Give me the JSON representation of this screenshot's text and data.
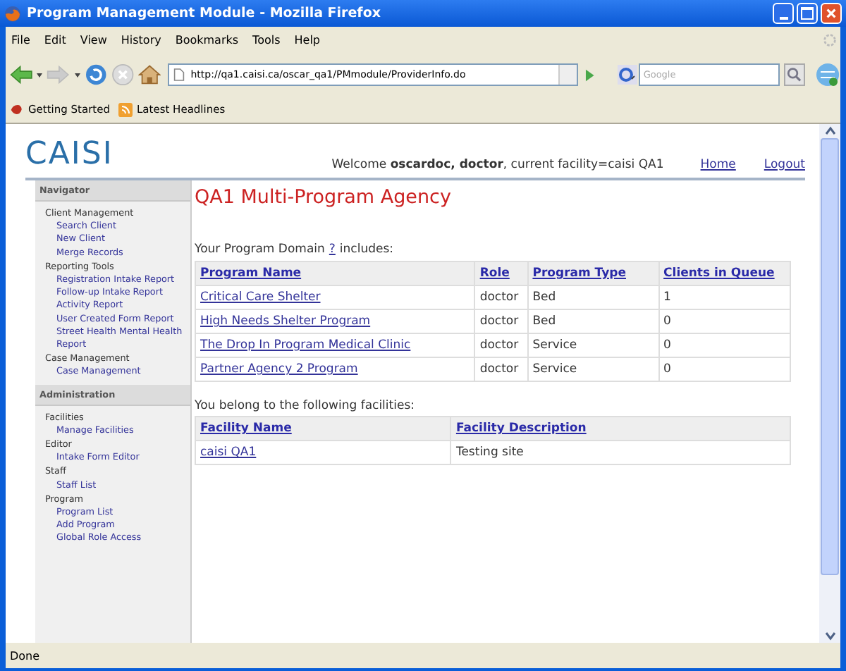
{
  "window": {
    "title": "Program Management Module - Mozilla Firefox"
  },
  "menu": [
    "File",
    "Edit",
    "View",
    "History",
    "Bookmarks",
    "Tools",
    "Help"
  ],
  "address": {
    "value": "http://qa1.caisi.ca/oscar_qa1/PMmodule/ProviderInfo.do"
  },
  "search": {
    "placeholder": "Google"
  },
  "bookmarks": [
    "Getting Started",
    "Latest Headlines"
  ],
  "header": {
    "logo": "CAISI",
    "welcome": "Welcome **oscardoc, doctor**, current facility=caisi QA1",
    "links": [
      "Home",
      "Logout"
    ]
  },
  "sidebar": [
    {
      "title": "Navigator",
      "groups": [
        {
          "label": "Client Management",
          "children": [
            {
              "label": "Search Client"
            },
            {
              "label": "New Client"
            },
            {
              "label": "Merge Records"
            }
          ]
        },
        {
          "label": "Reporting Tools",
          "children": [
            {
              "label": "Registration Intake Report"
            },
            {
              "label": "Follow-up Intake Report"
            },
            {
              "label": "Activity Report"
            },
            {
              "label": "User Created Form Report"
            },
            {
              "label": "Street Health Mental Health Report"
            }
          ]
        },
        {
          "label": "Case Management",
          "children": [
            {
              "label": "Case Management"
            }
          ]
        }
      ]
    },
    {
      "title": "Administration",
      "groups": [
        {
          "label": "Facilities",
          "children": [
            {
              "label": "Manage Facilities"
            }
          ]
        },
        {
          "label": "Editor",
          "children": [
            {
              "label": "Intake Form Editor"
            }
          ]
        },
        {
          "label": "Staff",
          "children": [
            {
              "label": "Staff List"
            }
          ]
        },
        {
          "label": "Program",
          "children": [
            {
              "label": "Program List"
            },
            {
              "label": "Add Program"
            },
            {
              "label": "Global Role Access"
            }
          ]
        }
      ]
    }
  ],
  "page_title": "QA1 Multi-Program Agency",
  "programs": {
    "intro_before": "Your Program Domain",
    "help_link": "?",
    "intro_after": "includes:",
    "columns": [
      "Program Name",
      "Role",
      "Program Type",
      "Clients in Queue"
    ],
    "rows": [
      [
        "Critical Care Shelter",
        "doctor",
        "Bed",
        "1"
      ],
      [
        "High Needs Shelter Program",
        "doctor",
        "Bed",
        "0"
      ],
      [
        "The Drop In Program Medical Clinic",
        "doctor",
        "Service",
        "0"
      ],
      [
        "Partner Agency 2 Program",
        "doctor",
        "Service",
        "0"
      ]
    ]
  },
  "facilities": {
    "intro": "You belong to the following facilities:",
    "columns": [
      "Facility Name",
      "Facility Description"
    ],
    "rows": [
      [
        "caisi QA1",
        "Testing site"
      ]
    ]
  },
  "status_bar": "Done"
}
